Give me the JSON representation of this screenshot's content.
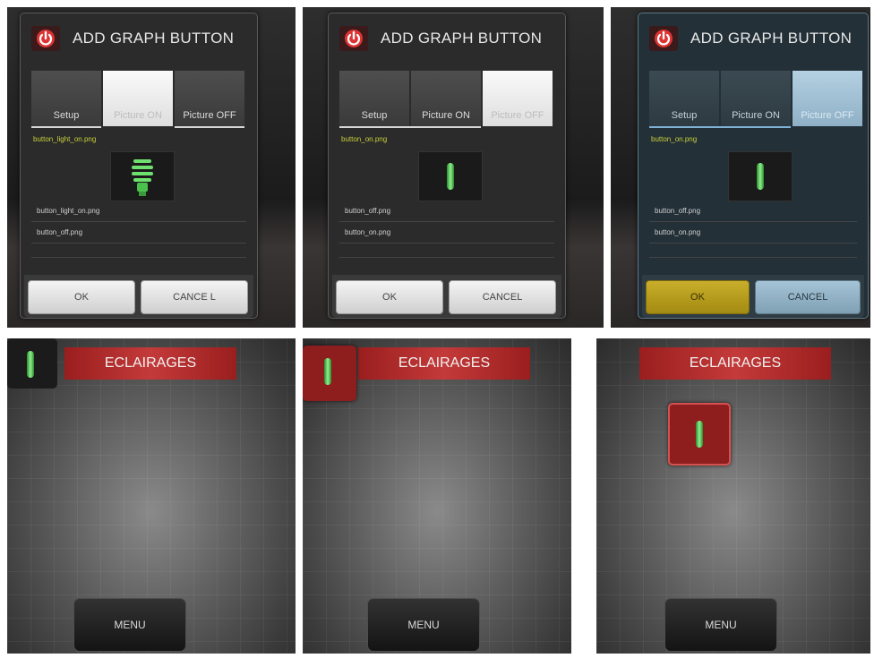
{
  "dialog": {
    "title": "ADD GRAPH BUTTON",
    "tabs": [
      "Setup",
      "Picture ON",
      "Picture OFF"
    ],
    "ok_label": "OK",
    "cancel_label": "CANCEL"
  },
  "dialogs": [
    {
      "selected_tab": "Picture ON",
      "file_name": "button_light_on.png",
      "preview_icon": "cfl-bulb-icon",
      "list_items": [
        "button_light_on.png",
        "button_off.png"
      ],
      "cancel_label": "CANCE L"
    },
    {
      "selected_tab": "Picture OFF",
      "file_name": "button_on.png",
      "preview_icon": "green-bar-icon",
      "list_items": [
        "button_off.png",
        "button_on.png"
      ]
    },
    {
      "selected_tab": "Picture OFF",
      "file_name": "button_on.png",
      "preview_icon": "green-bar-icon",
      "list_items": [
        "button_off.png",
        "button_on.png"
      ],
      "highlighted_button": "OK"
    }
  ],
  "app": {
    "banner_title": "ECLAIRAGES",
    "menu_label": "MENU"
  },
  "colors": {
    "banner_red": "#b32a2a",
    "bar_green": "#7ee07e",
    "file_name_yellow": "#c9d03a",
    "ok_highlight": "#b89b1c",
    "tab_selected_blue": "#a9c8dc"
  }
}
